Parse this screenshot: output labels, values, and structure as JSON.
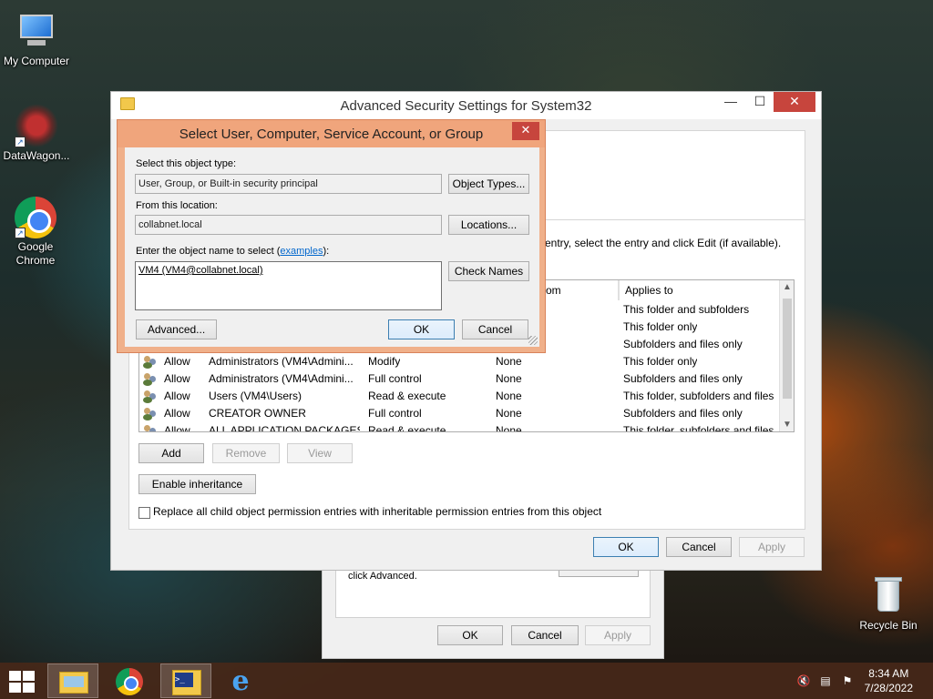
{
  "desktop": {
    "icons": [
      {
        "label": "My Computer"
      },
      {
        "label": "DataWagon..."
      },
      {
        "label": "Google Chrome"
      },
      {
        "label": "Recycle Bin"
      }
    ]
  },
  "props_window": {
    "text": "click Advanced.",
    "ok": "OK",
    "cancel": "Cancel",
    "apply": "Apply"
  },
  "adv_window": {
    "title": "Advanced Security Settings for System32",
    "instruction": "entry, select the entry and click Edit (if available).",
    "columns": [
      "om",
      "Applies to"
    ],
    "rows": [
      {
        "type": "",
        "principal": "",
        "access": "",
        "inherited": "",
        "applies": "This folder and subfolders"
      },
      {
        "type": "",
        "principal": "",
        "access": "",
        "inherited": "",
        "applies": "This folder only"
      },
      {
        "type": "",
        "principal": "",
        "access": "",
        "inherited": "",
        "applies": "Subfolders and files only"
      },
      {
        "type": "Allow",
        "principal": "Administrators (VM4\\Admini...",
        "access": "Modify",
        "inherited": "None",
        "applies": "This folder only"
      },
      {
        "type": "Allow",
        "principal": "Administrators (VM4\\Admini...",
        "access": "Full control",
        "inherited": "None",
        "applies": "Subfolders and files only"
      },
      {
        "type": "Allow",
        "principal": "Users (VM4\\Users)",
        "access": "Read & execute",
        "inherited": "None",
        "applies": "This folder, subfolders and files"
      },
      {
        "type": "Allow",
        "principal": "CREATOR OWNER",
        "access": "Full control",
        "inherited": "None",
        "applies": "Subfolders and files only"
      },
      {
        "type": "Allow",
        "principal": "ALL APPLICATION PACKAGES",
        "access": "Read & execute",
        "inherited": "None",
        "applies": "This folder, subfolders and files"
      }
    ],
    "add": "Add",
    "remove": "Remove",
    "view": "View",
    "enable_inheritance": "Enable inheritance",
    "replace_checkbox": "Replace all child object permission entries with inheritable permission entries from this object",
    "ok": "OK",
    "cancel": "Cancel",
    "apply": "Apply"
  },
  "select_dialog": {
    "title": "Select User, Computer, Service Account, or Group",
    "object_type_label": "Select this object type:",
    "object_type_value": "User, Group, or Built-in security principal",
    "object_types_button": "Object Types...",
    "location_label": "From this location:",
    "location_value": "collabnet.local",
    "locations_button": "Locations...",
    "name_label": "Enter the object name to select (",
    "name_label_link": "examples",
    "name_label_end": "):",
    "name_value": "VM4 (VM4@collabnet.local)",
    "check_names_button": "Check Names",
    "advanced_button": "Advanced...",
    "ok": "OK",
    "cancel": "Cancel"
  },
  "taskbar": {
    "time": "8:34 AM",
    "date": "7/28/2022"
  }
}
